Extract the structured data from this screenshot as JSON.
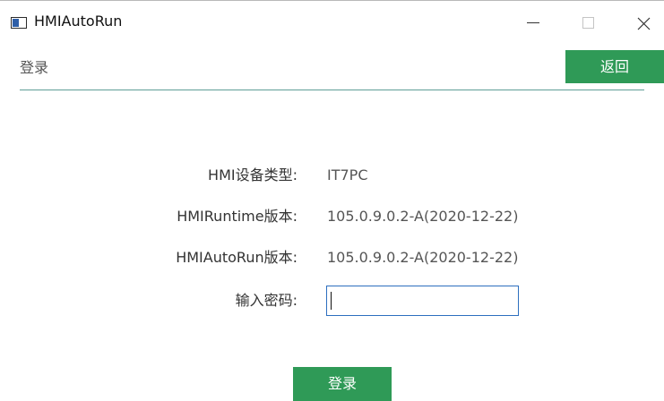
{
  "window": {
    "title": "HMIAutoRun",
    "icons": {
      "app": "app-window-icon",
      "minimize": "minimize-icon",
      "maximize": "maximize-icon",
      "close": "close-icon"
    }
  },
  "header": {
    "title": "登录",
    "back_label": "返回"
  },
  "info": {
    "device_type_label": "HMI设备类型:",
    "device_type_value": "IT7PC",
    "runtime_version_label": "HMIRuntime版本:",
    "runtime_version_value": "105.0.9.0.2-A(2020-12-22)",
    "autorun_version_label": "HMIAutoRun版本:",
    "autorun_version_value": "105.0.9.0.2-A(2020-12-22)"
  },
  "password": {
    "label": "输入密码:",
    "value": "",
    "placeholder": ""
  },
  "actions": {
    "login_label": "登录"
  },
  "colors": {
    "accent_green": "#2f9a57",
    "divider_teal": "#5f9e97",
    "input_border_blue": "#2d6fbf"
  }
}
